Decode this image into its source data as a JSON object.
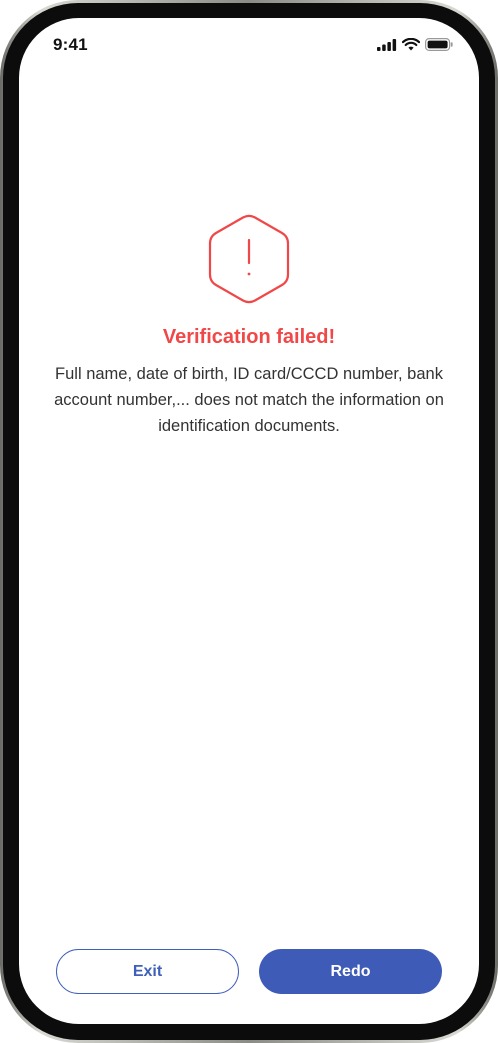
{
  "status_bar": {
    "time": "9:41",
    "icons": [
      "cellular-signal-icon",
      "wifi-icon",
      "battery-icon"
    ]
  },
  "error": {
    "icon": "warning-hexagon-icon",
    "title": "Verification failed!",
    "message": "Full name, date of birth, ID card/CCCD number, bank account number,... does not match the information on identification documents."
  },
  "actions": {
    "exit_label": "Exit",
    "redo_label": "Redo"
  },
  "colors": {
    "error": "#f04848",
    "primary": "#3f5bb8",
    "text": "#333333"
  }
}
